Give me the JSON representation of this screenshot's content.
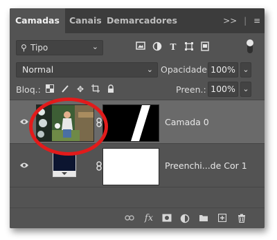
{
  "tabs": [
    {
      "label": "Camadas",
      "active": true
    },
    {
      "label": "Canais",
      "active": false
    },
    {
      "label": "Demarcadores",
      "active": false
    }
  ],
  "tab_right_icons": [
    ">>",
    "≡"
  ],
  "filter": {
    "label": "Tipo",
    "icons": [
      "image-filter-icon",
      "adjustment-filter-icon",
      "type-filter-icon",
      "shape-filter-icon",
      "smart-object-filter-icon"
    ]
  },
  "blend_mode": "Normal",
  "opacity": {
    "label": "Opacidade:",
    "value": "100%"
  },
  "lock": {
    "label": "Bloq.:"
  },
  "fill": {
    "label": "Preen.:",
    "value": "100%"
  },
  "layers": [
    {
      "name": "Camada 0",
      "visible": true,
      "selected": true
    },
    {
      "name": "Preenchi...de Cor 1",
      "visible": true,
      "selected": false
    }
  ],
  "footer_icons": [
    "link-icon",
    "fx-icon",
    "mask-icon",
    "adjustment-icon",
    "folder-icon",
    "new-layer-icon",
    "trash-icon"
  ],
  "colors": {
    "panel": "#535353",
    "tabbar": "#3c3c3c",
    "selected_row": "#6a6a6a",
    "highlight": "#e21b1b"
  }
}
